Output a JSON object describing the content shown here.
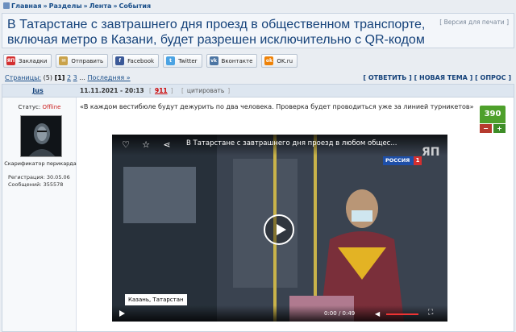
{
  "breadcrumb": {
    "home": "Главная",
    "sections": "Разделы",
    "feed": "Лента",
    "events": "События",
    "separator": "»"
  },
  "topic": {
    "title": "В Татарстане с завтрашнего дня проезд в общественном транспорте, включая метро в Казани, будет разрешен исключительно с QR-кодом",
    "print_version": "[ Версия для печати ]"
  },
  "share": [
    {
      "icon": "yap-icon",
      "label": "Закладки",
      "color": "#d32f2f",
      "glyph": "ЯП"
    },
    {
      "icon": "send-icon",
      "label": "Отправить",
      "color": "#c9a24a",
      "glyph": "✉"
    },
    {
      "icon": "facebook-icon",
      "label": "Facebook",
      "color": "#3b5998",
      "glyph": "f"
    },
    {
      "icon": "twitter-icon",
      "label": "Twitter",
      "color": "#4ba3e3",
      "glyph": "t"
    },
    {
      "icon": "vk-icon",
      "label": "Вконтакте",
      "color": "#4c75a3",
      "glyph": "vk"
    },
    {
      "icon": "ok-icon",
      "label": "OK.ru",
      "color": "#ee8208",
      "glyph": "ok"
    }
  ],
  "pager": {
    "label": "Страницы:",
    "count": "(5)",
    "current": "[1]",
    "p2": "2",
    "p3": "3",
    "ellipsis": "...",
    "last": "Последняя »"
  },
  "actions": {
    "reply": "[ ОТВЕТИТЬ ]",
    "new_topic": "[ НОВАЯ ТЕМА ]",
    "poll": "[ ОПРОС ]"
  },
  "post": {
    "author": "Jus",
    "datetime": "11.11.2021 - 20:13",
    "number": "911",
    "cite": "цитировать",
    "status_label": "Статус:",
    "status_value": "Offline",
    "user_title": "Скарификатор перикарда",
    "registered": "Регистрация: 30.05.06",
    "messages": "Сообщений: 355578",
    "text": "«В каждом вестибюле будут дежурить по два человека. Проверка будет проводиться уже за линией турникетов»",
    "rating": "390",
    "minus": "−",
    "plus": "+"
  },
  "video": {
    "title": "В Татарстане с завтрашнего дня проезд в любом общес...",
    "caption": "Казань, Татарстан",
    "channel": "РОССИЯ",
    "channel_num": "1",
    "logo": "ЯП",
    "time": "0:00 / 0:49"
  }
}
